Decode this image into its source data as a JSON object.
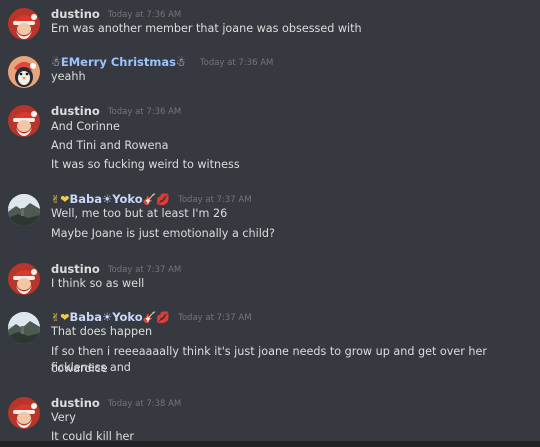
{
  "colors": {
    "background": "#36393f",
    "text": "#dcddde",
    "timestamp": "#72767d",
    "dustino": "#dcddde",
    "emery": "#9cc3ff",
    "baba": "#c7d8ff"
  },
  "messages": [
    {
      "author": "dustino",
      "timestamp": "Today at 7:36 AM",
      "avatar_icon": "santa-avatar",
      "lines": [
        "Em was another member that joane was obsessed with"
      ]
    },
    {
      "author": "EMerry Christmas",
      "prefix_emoji": "☃",
      "suffix_emoji": "☃",
      "timestamp": "Today at 7:36 AM",
      "avatar_icon": "penguin-santa-avatar",
      "lines": [
        "yeahh"
      ]
    },
    {
      "author": "dustino",
      "timestamp": "Today at 7:36 AM",
      "avatar_icon": "santa-avatar",
      "lines": [
        "And Corinne",
        "And Tini and Rowena",
        "It was so fucking weird to witness"
      ]
    },
    {
      "author": "Baba☀Yoko",
      "prefix_emoji": "✌❤",
      "suffix_emoji": "🎸💋",
      "timestamp": "Today at 7:37 AM",
      "avatar_icon": "landscape-avatar",
      "lines": [
        "Well, me too but at least I'm 26",
        "Maybe Joane is just emotionally a child?"
      ]
    },
    {
      "author": "dustino",
      "timestamp": "Today at 7:37 AM",
      "avatar_icon": "santa-avatar",
      "lines": [
        "I think so as well"
      ]
    },
    {
      "author": "Baba☀Yoko",
      "prefix_emoji": "✌❤",
      "suffix_emoji": "🎸💋",
      "timestamp": "Today at 7:37 AM",
      "avatar_icon": "landscape-avatar",
      "lines": [
        "That does happen",
        "If so then i reeeaaaally think it's just joane needs to grow up and get over her fickleness and",
        "cowardice"
      ]
    },
    {
      "author": "dustino",
      "timestamp": "Today at 7:38 AM",
      "avatar_icon": "santa-avatar",
      "lines": [
        "Very",
        "It could kill her"
      ]
    }
  ]
}
